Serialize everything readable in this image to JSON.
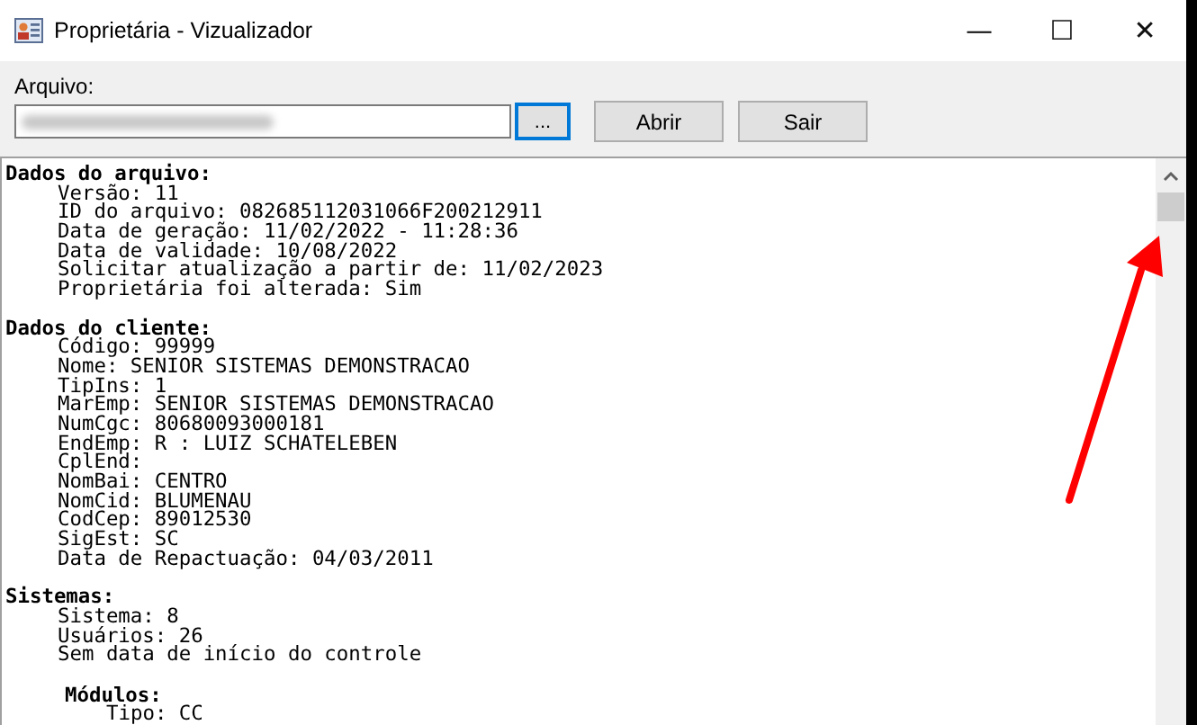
{
  "window": {
    "title": "Proprietária - Vizualizador",
    "controls": [
      "—",
      "☐",
      "✕"
    ]
  },
  "file_label": "Arquivo:",
  "browse_button": "...",
  "buttons": [
    "Abrir",
    "Sair"
  ],
  "content": [
    {
      "kind": "heading",
      "text": "Dados do arquivo:"
    },
    {
      "kind": "field",
      "text": "Versão: 11"
    },
    {
      "kind": "field",
      "text": "ID do arquivo: 082685112031066F200212911"
    },
    {
      "kind": "field",
      "text": "Data de geração: 11/02/2022 - 11:28:36"
    },
    {
      "kind": "field",
      "text": "Data de validade: 10/08/2022"
    },
    {
      "kind": "field",
      "text": "Solicitar atualização a partir de: 11/02/2023"
    },
    {
      "kind": "field",
      "text": "Proprietária foi alterada: Sim"
    },
    {
      "kind": "blank"
    },
    {
      "kind": "heading",
      "text": "Dados do cliente:"
    },
    {
      "kind": "field",
      "text": "Código: 99999"
    },
    {
      "kind": "field",
      "text": "Nome: SENIOR SISTEMAS DEMONSTRACAO"
    },
    {
      "kind": "field",
      "text": "TipIns: 1"
    },
    {
      "kind": "field",
      "text": "MarEmp: SENIOR SISTEMAS DEMONSTRACAO"
    },
    {
      "kind": "field",
      "text": "NumCgc: 80680093000181"
    },
    {
      "kind": "field",
      "text": "EndEmp: R : LUIZ SCHATELEBEN"
    },
    {
      "kind": "field",
      "text": "CplEnd:"
    },
    {
      "kind": "field",
      "text": "NomBai: CENTRO"
    },
    {
      "kind": "field",
      "text": "NomCid: BLUMENAU"
    },
    {
      "kind": "field",
      "text": "CodCep: 89012530"
    },
    {
      "kind": "field",
      "text": "SigEst: SC"
    },
    {
      "kind": "field",
      "text": "Data de Repactuação: 04/03/2011"
    },
    {
      "kind": "blank"
    },
    {
      "kind": "heading",
      "text": "Sistemas:"
    },
    {
      "kind": "field",
      "text": "Sistema: 8"
    },
    {
      "kind": "field",
      "text": "Usuários: 26"
    },
    {
      "kind": "field",
      "text": "Sem data de início do controle"
    },
    {
      "kind": "blank"
    },
    {
      "kind": "subheading",
      "text": "Módulos:"
    },
    {
      "kind": "subfield",
      "text": "Tipo: CC"
    }
  ]
}
